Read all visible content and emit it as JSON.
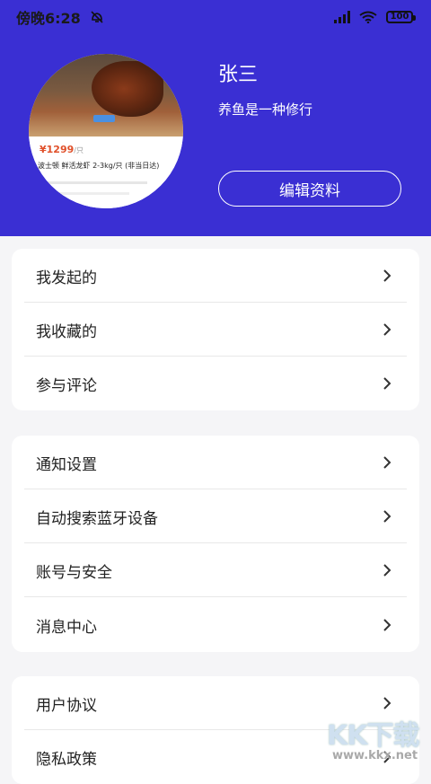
{
  "status_bar": {
    "time": "傍晚6:28",
    "battery": "100"
  },
  "profile": {
    "name": "张三",
    "motto": "养鱼是一种修行",
    "edit_label": "编辑资料",
    "avatar_card": {
      "price": "¥1299",
      "price_unit": "/只",
      "product_title": "波士顿 鲜活龙虾 2-3kg/只 (非当日达)"
    }
  },
  "groups": [
    {
      "items": [
        {
          "label": "我发起的"
        },
        {
          "label": "我收藏的"
        },
        {
          "label": "参与评论"
        }
      ]
    },
    {
      "items": [
        {
          "label": "通知设置"
        },
        {
          "label": "自动搜索蓝牙设备"
        },
        {
          "label": "账号与安全"
        },
        {
          "label": "消息中心"
        }
      ]
    },
    {
      "items": [
        {
          "label": "用户协议"
        },
        {
          "label": "隐私政策"
        }
      ]
    }
  ],
  "watermark": {
    "brand": "KK下载",
    "url": "www.kkx.net"
  },
  "colors": {
    "header_bg": "#3a2fd3",
    "page_bg": "#f5f5f7",
    "card_bg": "#ffffff"
  }
}
